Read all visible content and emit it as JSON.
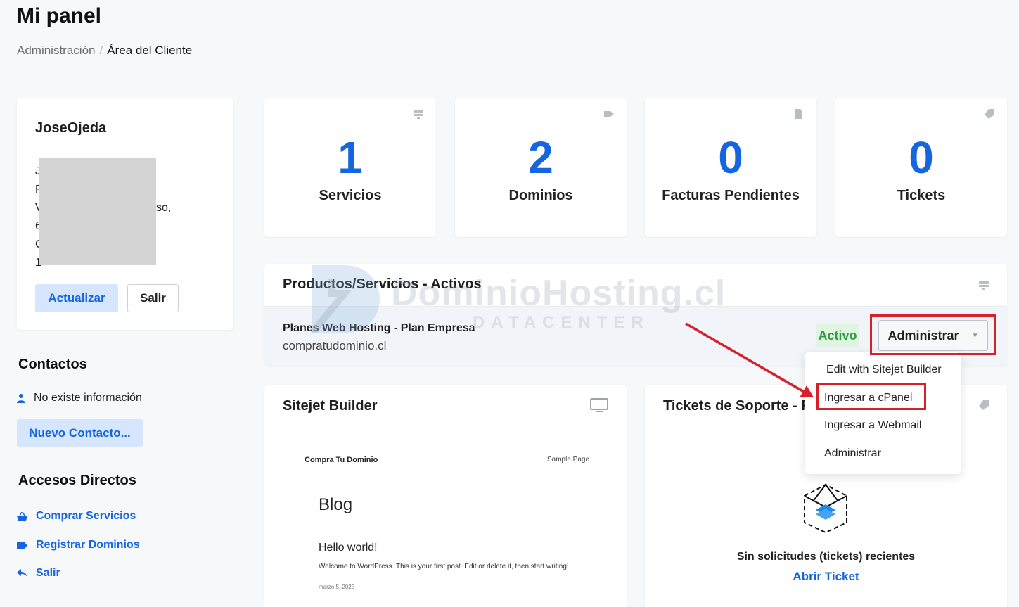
{
  "header": {
    "title": "Mi panel",
    "breadcrumb": [
      "Administración",
      "Área del Cliente"
    ]
  },
  "user": {
    "name": "JoseOjeda",
    "address_visible": [
      "J",
      "F",
      "V",
      "6",
      "C",
      "1"
    ],
    "address_partial": "so,",
    "update_label": "Actualizar",
    "logout_label": "Salir"
  },
  "contacts": {
    "title": "Contactos",
    "empty": "No existe información",
    "new_label": "Nuevo Contacto..."
  },
  "shortcuts": {
    "title": "Accesos Directos",
    "items": [
      {
        "label": "Comprar Servicios",
        "icon": "basket-icon"
      },
      {
        "label": "Registrar Dominios",
        "icon": "tag-icon"
      },
      {
        "label": "Salir",
        "icon": "back-arrow-icon"
      }
    ]
  },
  "stats": [
    {
      "value": "1",
      "label": "Servicios",
      "icon": "server-icon"
    },
    {
      "value": "2",
      "label": "Dominios",
      "icon": "tag-icon"
    },
    {
      "value": "0",
      "label": "Facturas Pendientes",
      "icon": "file-icon"
    },
    {
      "value": "0",
      "label": "Tickets",
      "icon": "ticket-icon"
    }
  ],
  "products": {
    "title": "Productos/Servicios - Activos",
    "item_name": "Planes Web Hosting - Plan Empresa",
    "item_domain": "compratudominio.cl",
    "status": "Activo",
    "manage_label": "Administrar"
  },
  "dropdown": {
    "items": [
      "Edit with Sitejet Builder",
      "Ingresar a cPanel",
      "Ingresar a Webmail",
      "Administrar"
    ]
  },
  "sitejet": {
    "title": "Sitejet Builder",
    "preview": {
      "brand": "Compra Tu Dominio",
      "sample": "Sample Page",
      "blog": "Blog",
      "hello": "Hello world!",
      "welcome": "Welcome to WordPress. This is your first post. Edit or delete it, then start writing!",
      "date": "marzo 5, 2025"
    }
  },
  "tickets": {
    "title": "Tickets de Soporte - F",
    "empty": "Sin solicitudes (tickets) recientes",
    "open_label": "Abrir Ticket"
  },
  "watermark": {
    "text": "DominioHosting.cl",
    "sub": "DATACENTER"
  },
  "colors": {
    "accent": "#1565e0",
    "success": "#2e9d3f",
    "highlight": "#d8202a"
  }
}
